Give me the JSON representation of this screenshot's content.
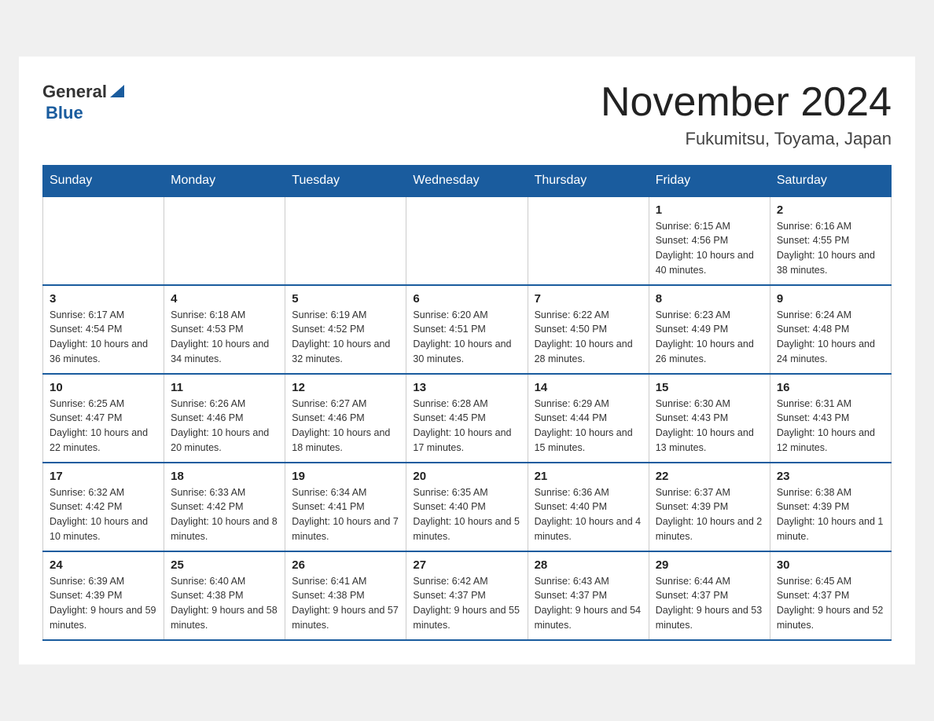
{
  "header": {
    "logo_general": "General",
    "logo_blue": "Blue",
    "month_title": "November 2024",
    "location": "Fukumitsu, Toyama, Japan"
  },
  "weekdays": [
    "Sunday",
    "Monday",
    "Tuesday",
    "Wednesday",
    "Thursday",
    "Friday",
    "Saturday"
  ],
  "weeks": [
    [
      {
        "day": "",
        "sunrise": "",
        "sunset": "",
        "daylight": ""
      },
      {
        "day": "",
        "sunrise": "",
        "sunset": "",
        "daylight": ""
      },
      {
        "day": "",
        "sunrise": "",
        "sunset": "",
        "daylight": ""
      },
      {
        "day": "",
        "sunrise": "",
        "sunset": "",
        "daylight": ""
      },
      {
        "day": "",
        "sunrise": "",
        "sunset": "",
        "daylight": ""
      },
      {
        "day": "1",
        "sunrise": "Sunrise: 6:15 AM",
        "sunset": "Sunset: 4:56 PM",
        "daylight": "Daylight: 10 hours and 40 minutes."
      },
      {
        "day": "2",
        "sunrise": "Sunrise: 6:16 AM",
        "sunset": "Sunset: 4:55 PM",
        "daylight": "Daylight: 10 hours and 38 minutes."
      }
    ],
    [
      {
        "day": "3",
        "sunrise": "Sunrise: 6:17 AM",
        "sunset": "Sunset: 4:54 PM",
        "daylight": "Daylight: 10 hours and 36 minutes."
      },
      {
        "day": "4",
        "sunrise": "Sunrise: 6:18 AM",
        "sunset": "Sunset: 4:53 PM",
        "daylight": "Daylight: 10 hours and 34 minutes."
      },
      {
        "day": "5",
        "sunrise": "Sunrise: 6:19 AM",
        "sunset": "Sunset: 4:52 PM",
        "daylight": "Daylight: 10 hours and 32 minutes."
      },
      {
        "day": "6",
        "sunrise": "Sunrise: 6:20 AM",
        "sunset": "Sunset: 4:51 PM",
        "daylight": "Daylight: 10 hours and 30 minutes."
      },
      {
        "day": "7",
        "sunrise": "Sunrise: 6:22 AM",
        "sunset": "Sunset: 4:50 PM",
        "daylight": "Daylight: 10 hours and 28 minutes."
      },
      {
        "day": "8",
        "sunrise": "Sunrise: 6:23 AM",
        "sunset": "Sunset: 4:49 PM",
        "daylight": "Daylight: 10 hours and 26 minutes."
      },
      {
        "day": "9",
        "sunrise": "Sunrise: 6:24 AM",
        "sunset": "Sunset: 4:48 PM",
        "daylight": "Daylight: 10 hours and 24 minutes."
      }
    ],
    [
      {
        "day": "10",
        "sunrise": "Sunrise: 6:25 AM",
        "sunset": "Sunset: 4:47 PM",
        "daylight": "Daylight: 10 hours and 22 minutes."
      },
      {
        "day": "11",
        "sunrise": "Sunrise: 6:26 AM",
        "sunset": "Sunset: 4:46 PM",
        "daylight": "Daylight: 10 hours and 20 minutes."
      },
      {
        "day": "12",
        "sunrise": "Sunrise: 6:27 AM",
        "sunset": "Sunset: 4:46 PM",
        "daylight": "Daylight: 10 hours and 18 minutes."
      },
      {
        "day": "13",
        "sunrise": "Sunrise: 6:28 AM",
        "sunset": "Sunset: 4:45 PM",
        "daylight": "Daylight: 10 hours and 17 minutes."
      },
      {
        "day": "14",
        "sunrise": "Sunrise: 6:29 AM",
        "sunset": "Sunset: 4:44 PM",
        "daylight": "Daylight: 10 hours and 15 minutes."
      },
      {
        "day": "15",
        "sunrise": "Sunrise: 6:30 AM",
        "sunset": "Sunset: 4:43 PM",
        "daylight": "Daylight: 10 hours and 13 minutes."
      },
      {
        "day": "16",
        "sunrise": "Sunrise: 6:31 AM",
        "sunset": "Sunset: 4:43 PM",
        "daylight": "Daylight: 10 hours and 12 minutes."
      }
    ],
    [
      {
        "day": "17",
        "sunrise": "Sunrise: 6:32 AM",
        "sunset": "Sunset: 4:42 PM",
        "daylight": "Daylight: 10 hours and 10 minutes."
      },
      {
        "day": "18",
        "sunrise": "Sunrise: 6:33 AM",
        "sunset": "Sunset: 4:42 PM",
        "daylight": "Daylight: 10 hours and 8 minutes."
      },
      {
        "day": "19",
        "sunrise": "Sunrise: 6:34 AM",
        "sunset": "Sunset: 4:41 PM",
        "daylight": "Daylight: 10 hours and 7 minutes."
      },
      {
        "day": "20",
        "sunrise": "Sunrise: 6:35 AM",
        "sunset": "Sunset: 4:40 PM",
        "daylight": "Daylight: 10 hours and 5 minutes."
      },
      {
        "day": "21",
        "sunrise": "Sunrise: 6:36 AM",
        "sunset": "Sunset: 4:40 PM",
        "daylight": "Daylight: 10 hours and 4 minutes."
      },
      {
        "day": "22",
        "sunrise": "Sunrise: 6:37 AM",
        "sunset": "Sunset: 4:39 PM",
        "daylight": "Daylight: 10 hours and 2 minutes."
      },
      {
        "day": "23",
        "sunrise": "Sunrise: 6:38 AM",
        "sunset": "Sunset: 4:39 PM",
        "daylight": "Daylight: 10 hours and 1 minute."
      }
    ],
    [
      {
        "day": "24",
        "sunrise": "Sunrise: 6:39 AM",
        "sunset": "Sunset: 4:39 PM",
        "daylight": "Daylight: 9 hours and 59 minutes."
      },
      {
        "day": "25",
        "sunrise": "Sunrise: 6:40 AM",
        "sunset": "Sunset: 4:38 PM",
        "daylight": "Daylight: 9 hours and 58 minutes."
      },
      {
        "day": "26",
        "sunrise": "Sunrise: 6:41 AM",
        "sunset": "Sunset: 4:38 PM",
        "daylight": "Daylight: 9 hours and 57 minutes."
      },
      {
        "day": "27",
        "sunrise": "Sunrise: 6:42 AM",
        "sunset": "Sunset: 4:37 PM",
        "daylight": "Daylight: 9 hours and 55 minutes."
      },
      {
        "day": "28",
        "sunrise": "Sunrise: 6:43 AM",
        "sunset": "Sunset: 4:37 PM",
        "daylight": "Daylight: 9 hours and 54 minutes."
      },
      {
        "day": "29",
        "sunrise": "Sunrise: 6:44 AM",
        "sunset": "Sunset: 4:37 PM",
        "daylight": "Daylight: 9 hours and 53 minutes."
      },
      {
        "day": "30",
        "sunrise": "Sunrise: 6:45 AM",
        "sunset": "Sunset: 4:37 PM",
        "daylight": "Daylight: 9 hours and 52 minutes."
      }
    ]
  ]
}
